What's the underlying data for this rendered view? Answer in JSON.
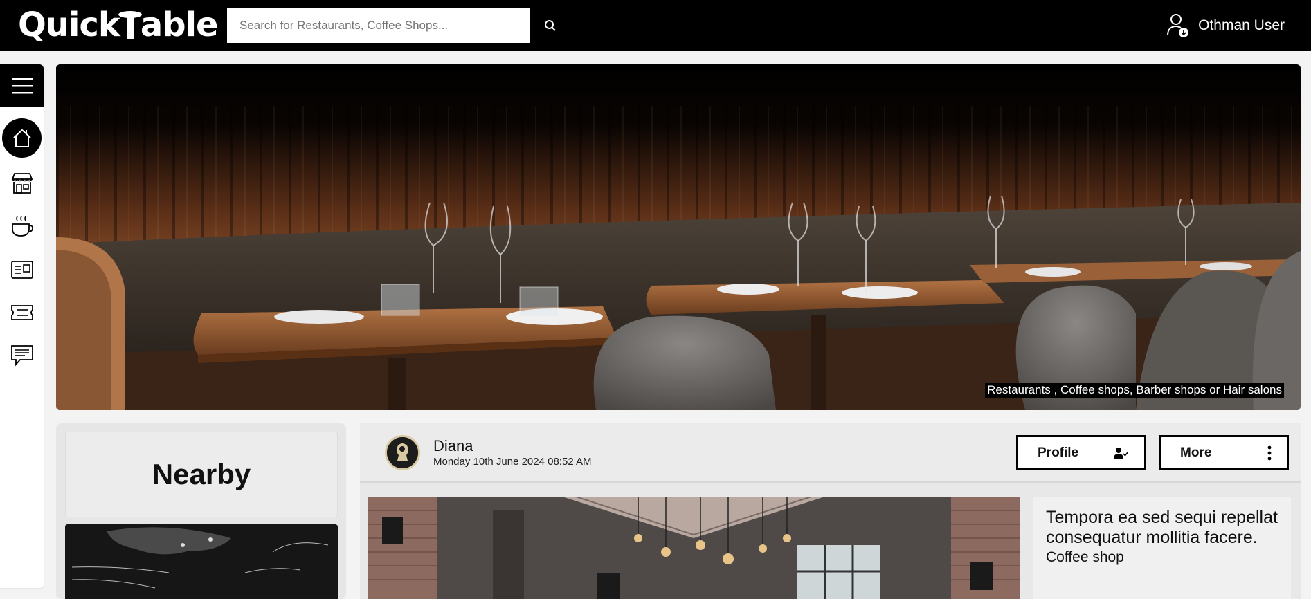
{
  "app": {
    "logo_text_before": "Quick",
    "logo_text_after": "able"
  },
  "search": {
    "placeholder": "Search for Restaurants, Coffee Shops..."
  },
  "user": {
    "name": "Othman User"
  },
  "sidebar": {
    "items": [
      {
        "name": "home",
        "icon": "home-icon",
        "active": true
      },
      {
        "name": "stores",
        "icon": "storefront-icon"
      },
      {
        "name": "coffee",
        "icon": "coffee-cup-icon"
      },
      {
        "name": "news",
        "icon": "newspaper-icon"
      },
      {
        "name": "tickets",
        "icon": "ticket-icon"
      },
      {
        "name": "messages",
        "icon": "chat-icon"
      }
    ]
  },
  "hero": {
    "caption": "Restaurants , Coffee shops, Barber shops or Hair salons"
  },
  "nearby": {
    "title": "Nearby"
  },
  "post": {
    "author": "Diana",
    "date": "Monday 10th June 2024 08:52 AM",
    "profile_label": "Profile",
    "more_label": "More",
    "title": "Tempora ea sed sequi repellat consequatur mollitia facere.",
    "category": "Coffee shop"
  },
  "colors": {
    "topbar": "#000000",
    "accent": "#000000",
    "panel": "#e8e8e8"
  }
}
